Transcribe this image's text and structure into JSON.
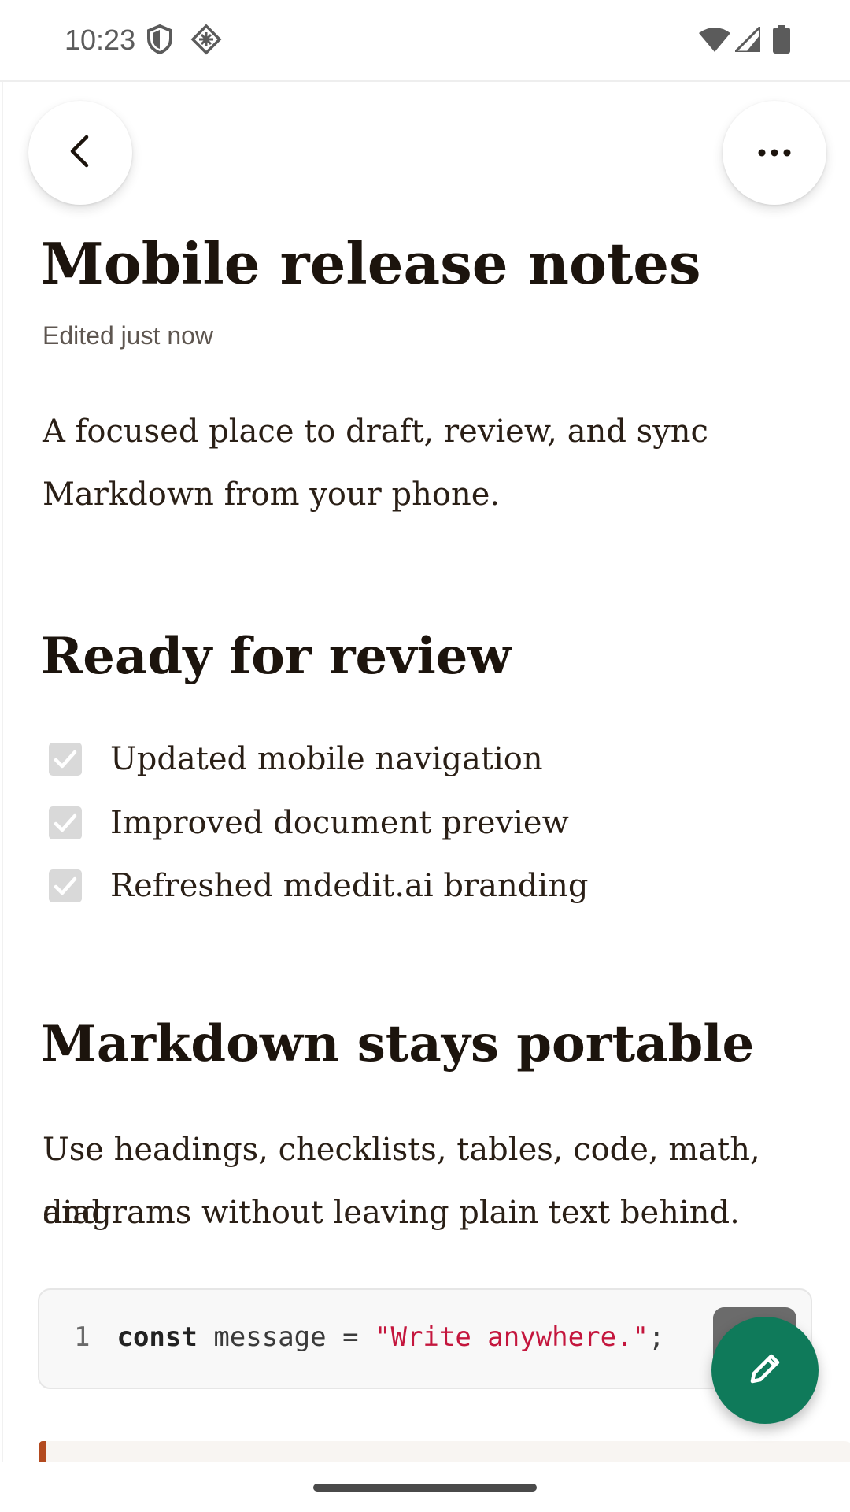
{
  "status_bar": {
    "time": "10:23",
    "icons": [
      "shield-icon",
      "vpn-diamond-icon",
      "wifi-icon",
      "cell-signal-icon",
      "battery-icon"
    ]
  },
  "header": {
    "back_icon": "chevron-left-icon",
    "more_icon": "more-horizontal-icon"
  },
  "document": {
    "title": "Mobile release notes",
    "meta": "Edited just now",
    "intro_line1": "A focused place to draft, review, and sync",
    "intro_line2": "Markdown from your phone.",
    "section1": {
      "heading": "Ready for review",
      "checklist": [
        {
          "label": "Updated mobile navigation",
          "checked": true
        },
        {
          "label": "Improved document preview",
          "checked": true
        },
        {
          "label": "Refreshed mdedit.ai branding",
          "checked": true
        }
      ]
    },
    "section2": {
      "heading": "Markdown stays portable",
      "para_line1": "Use headings, checklists, tables, code, math, and",
      "para_line2": "diagrams without leaving plain text behind."
    },
    "code": {
      "line_number": "1",
      "keyword": "const",
      "rest": " message = ",
      "string": "\"Write anywhere.\"",
      "end": ";"
    }
  },
  "fab": {
    "icon": "pencil-edit-icon"
  },
  "colors": {
    "accent": "#0f7a5a",
    "quote_border": "#b34a1f",
    "code_string": "#c4163d"
  }
}
